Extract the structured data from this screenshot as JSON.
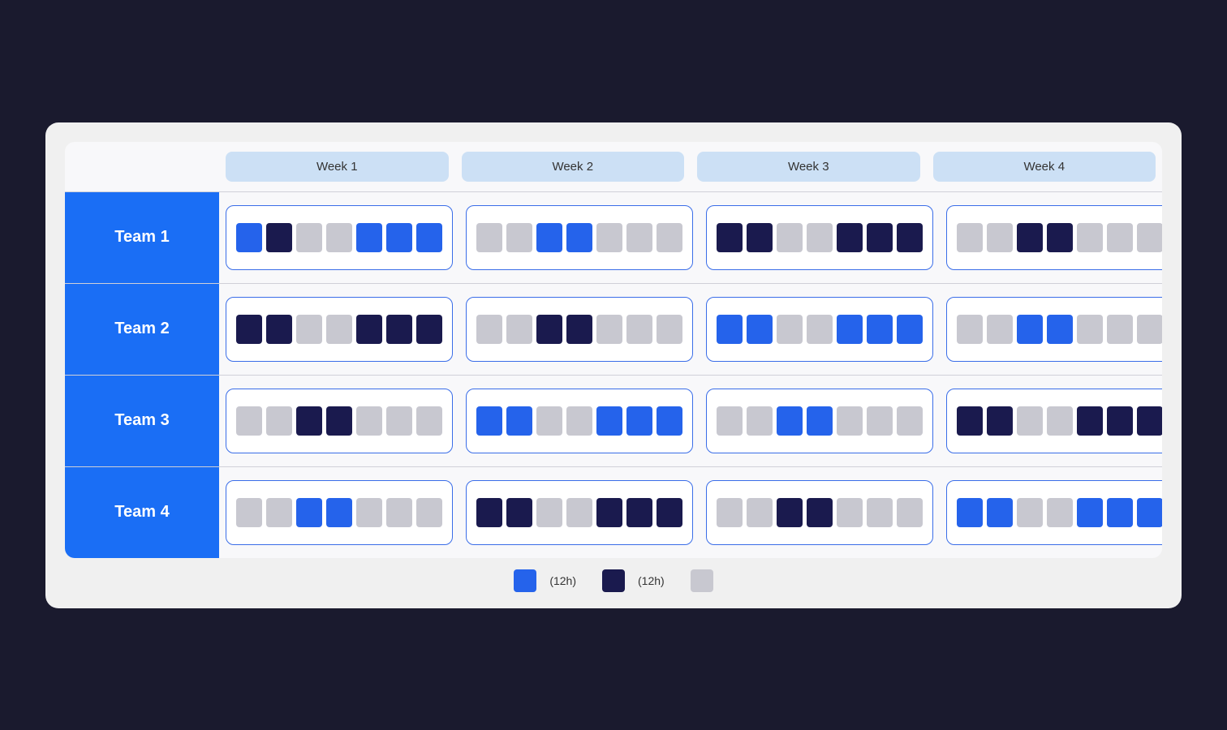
{
  "weeks": [
    "Week 1",
    "Week 2",
    "Week 3",
    "Week 4"
  ],
  "teams": [
    {
      "label": "Team 1",
      "weeks": [
        [
          "blue",
          "dark",
          "gray",
          "gray",
          "blue",
          "blue",
          "blue"
        ],
        [
          "gray",
          "gray",
          "blue",
          "blue",
          "gray",
          "gray",
          "gray"
        ],
        [
          "dark",
          "dark",
          "gray",
          "gray",
          "dark",
          "dark",
          "dark"
        ],
        [
          "gray",
          "gray",
          "dark",
          "dark",
          "gray",
          "gray",
          "gray"
        ]
      ]
    },
    {
      "label": "Team 2",
      "weeks": [
        [
          "dark",
          "dark",
          "gray",
          "gray",
          "dark",
          "dark",
          "dark"
        ],
        [
          "gray",
          "gray",
          "dark",
          "dark",
          "gray",
          "gray",
          "gray"
        ],
        [
          "blue",
          "blue",
          "gray",
          "gray",
          "blue",
          "blue",
          "blue"
        ],
        [
          "gray",
          "gray",
          "blue",
          "blue",
          "gray",
          "gray",
          "gray"
        ]
      ]
    },
    {
      "label": "Team 3",
      "weeks": [
        [
          "gray",
          "gray",
          "dark",
          "dark",
          "gray",
          "gray",
          "gray"
        ],
        [
          "blue",
          "blue",
          "gray",
          "gray",
          "blue",
          "blue",
          "blue"
        ],
        [
          "gray",
          "gray",
          "blue",
          "blue",
          "gray",
          "gray",
          "gray"
        ],
        [
          "dark",
          "dark",
          "gray",
          "gray",
          "dark",
          "dark",
          "dark"
        ]
      ]
    },
    {
      "label": "Team 4",
      "weeks": [
        [
          "gray",
          "gray",
          "blue",
          "blue",
          "gray",
          "gray",
          "gray"
        ],
        [
          "dark",
          "dark",
          "gray",
          "gray",
          "dark",
          "dark",
          "dark"
        ],
        [
          "gray",
          "gray",
          "dark",
          "dark",
          "gray",
          "gray",
          "gray"
        ],
        [
          "blue",
          "blue",
          "gray",
          "gray",
          "blue",
          "blue",
          "blue"
        ]
      ]
    }
  ],
  "legend": [
    {
      "color": "#2563eb",
      "label": "(12h)"
    },
    {
      "color": "#1a1a4e",
      "label": "(12h)"
    },
    {
      "color": "#c8c8d0",
      "label": ""
    }
  ]
}
